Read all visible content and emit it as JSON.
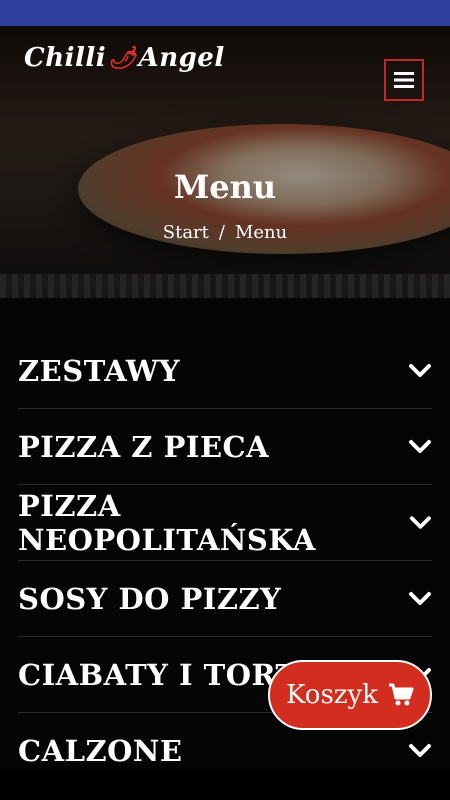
{
  "header": {
    "logo_text_1": "Chilli",
    "logo_text_2": "Angel",
    "menu_icon": "hamburger-icon"
  },
  "hero": {
    "title": "Menu",
    "breadcrumb": [
      {
        "label": "Start"
      },
      {
        "label": "Menu"
      }
    ],
    "breadcrumb_separator": "/"
  },
  "categories": [
    {
      "label": "ZESTAWY",
      "icon": "chevron-down-icon"
    },
    {
      "label": "PIZZA Z PIECA",
      "icon": "chevron-down-icon"
    },
    {
      "label": "PIZZA NEOPOLITAŃSKA",
      "icon": "chevron-down-icon"
    },
    {
      "label": "SOSY DO PIZZY",
      "icon": "chevron-down-icon"
    },
    {
      "label": "CIABATY I TORTILLE",
      "icon": "chevron-down-icon"
    },
    {
      "label": "CALZONE",
      "icon": "chevron-down-icon"
    }
  ],
  "cart": {
    "label": "Koszyk",
    "icon": "cart-icon",
    "color": "#d32d1f"
  },
  "colors": {
    "status_bar": "#2f3f9e",
    "accent_red": "#c02a2a"
  }
}
